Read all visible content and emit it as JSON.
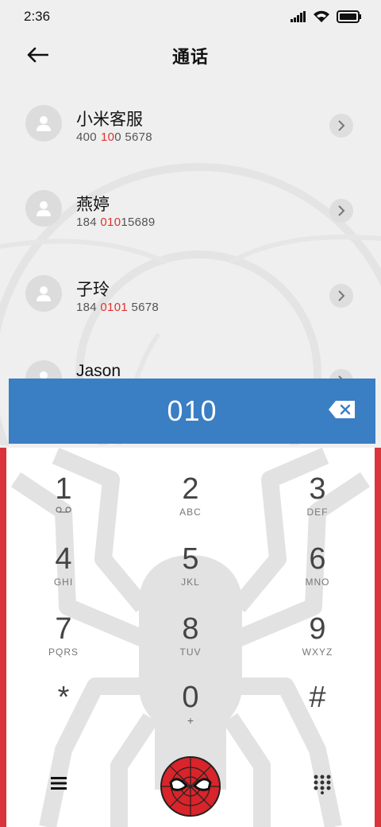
{
  "status_bar": {
    "time": "2:36"
  },
  "header": {
    "title": "通话"
  },
  "contacts": [
    {
      "name": "小米客服",
      "number_parts": [
        "400",
        " ",
        "10",
        "0",
        " 5678"
      ],
      "highlight": [
        false,
        false,
        true,
        false,
        false
      ]
    },
    {
      "name": "燕婷",
      "number_parts": [
        "184 ",
        "010",
        "15689"
      ],
      "highlight": [
        false,
        true,
        false
      ]
    },
    {
      "name": "子玲",
      "number_parts": [
        "184 ",
        "0101",
        " 5678"
      ],
      "highlight": [
        false,
        true,
        false
      ]
    },
    {
      "name": "Jason"
    }
  ],
  "dial_input": {
    "value": "010"
  },
  "keypad": {
    "keys": [
      {
        "digit": "1",
        "sub": "voicemail"
      },
      {
        "digit": "2",
        "letters": "ABC"
      },
      {
        "digit": "3",
        "letters": "DEF"
      },
      {
        "digit": "4",
        "letters": "GHI"
      },
      {
        "digit": "5",
        "letters": "JKL"
      },
      {
        "digit": "6",
        "letters": "MNO"
      },
      {
        "digit": "7",
        "letters": "PQRS"
      },
      {
        "digit": "8",
        "letters": "TUV"
      },
      {
        "digit": "9",
        "letters": "WXYZ"
      },
      {
        "digit": "*"
      },
      {
        "digit": "0",
        "letters": "+"
      },
      {
        "digit": "#"
      }
    ]
  },
  "colors": {
    "accent_blue": "#3a7ec4",
    "highlight_red": "#e0322f",
    "theme_red": "#d9353a"
  },
  "icons": [
    "back-arrow-icon",
    "signal-icon",
    "wifi-icon",
    "battery-icon",
    "person-icon",
    "chevron-right-icon",
    "backspace-icon",
    "voicemail-icon",
    "menu-icon",
    "spiderman-call-icon",
    "dialpad-grid-icon"
  ]
}
